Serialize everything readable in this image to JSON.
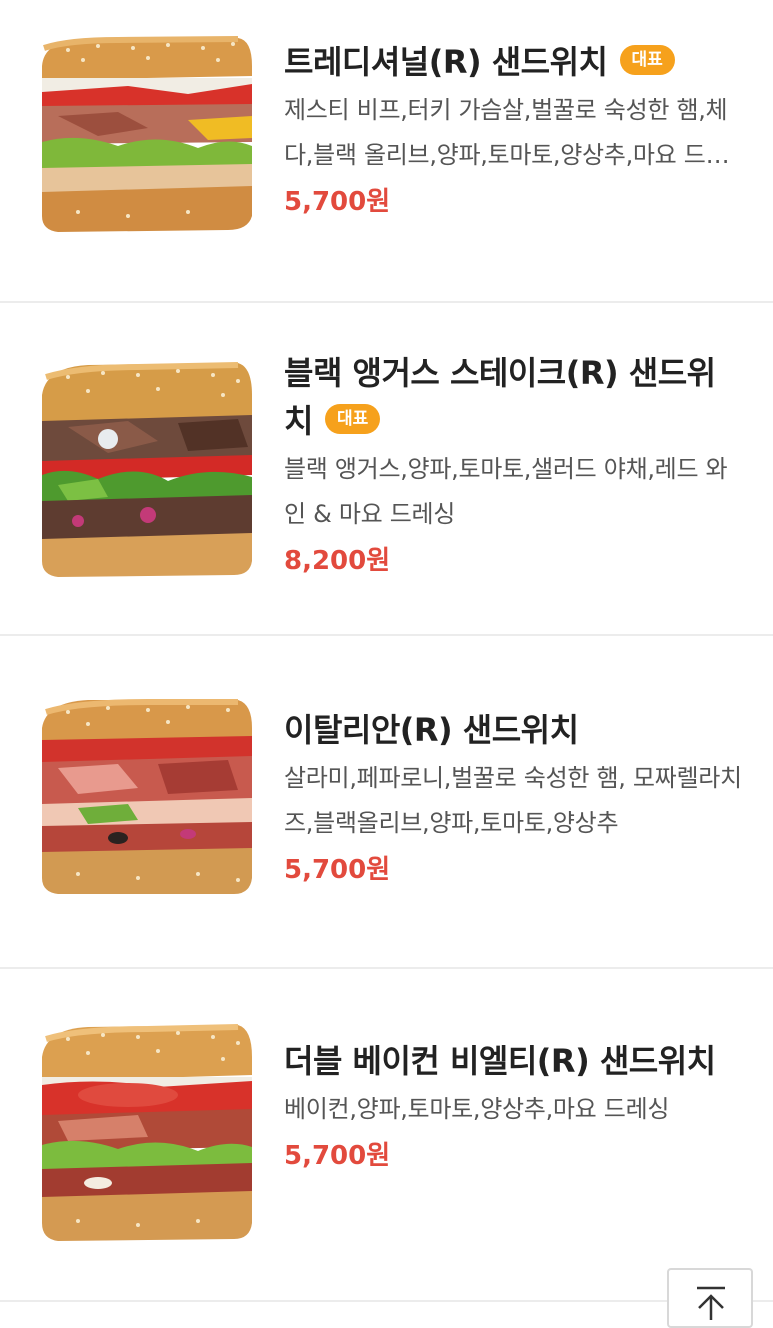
{
  "menu": {
    "items": [
      {
        "title": "트레디셔널(R) 샌드위치",
        "badge": "대표",
        "description": "제스티 비프,터키 가슴살,벌꿀로 숙성한 햄,체다,블랙 올리브,양파,토마토,양상추,마요 드레싱",
        "price": "5,700원"
      },
      {
        "title": "블랙 앵거스 스테이크(R) 샌드위치",
        "badge": "대표",
        "description": "블랙 앵거스,양파,토마토,샐러드 야채,레드 와인 & 마요 드레싱",
        "price": "8,200원"
      },
      {
        "title": "이탈리안(R) 샌드위치",
        "description": "살라미,페파로니,벌꿀로 숙성한 햄, 모짜렐라치즈,블랙올리브,양파,토마토,양상추",
        "price": "5,700원"
      },
      {
        "title": "더블 베이컨 비엘티(R) 샌드위치",
        "description": "베이컨,양파,토마토,양상추,마요 드레싱",
        "price": "5,700원"
      }
    ]
  },
  "colors": {
    "price": "#e24a3d",
    "badge": "#f6a11c",
    "divider": "#ececec"
  },
  "icons": {
    "scroll_top": "arrow-up-to-top-icon"
  }
}
